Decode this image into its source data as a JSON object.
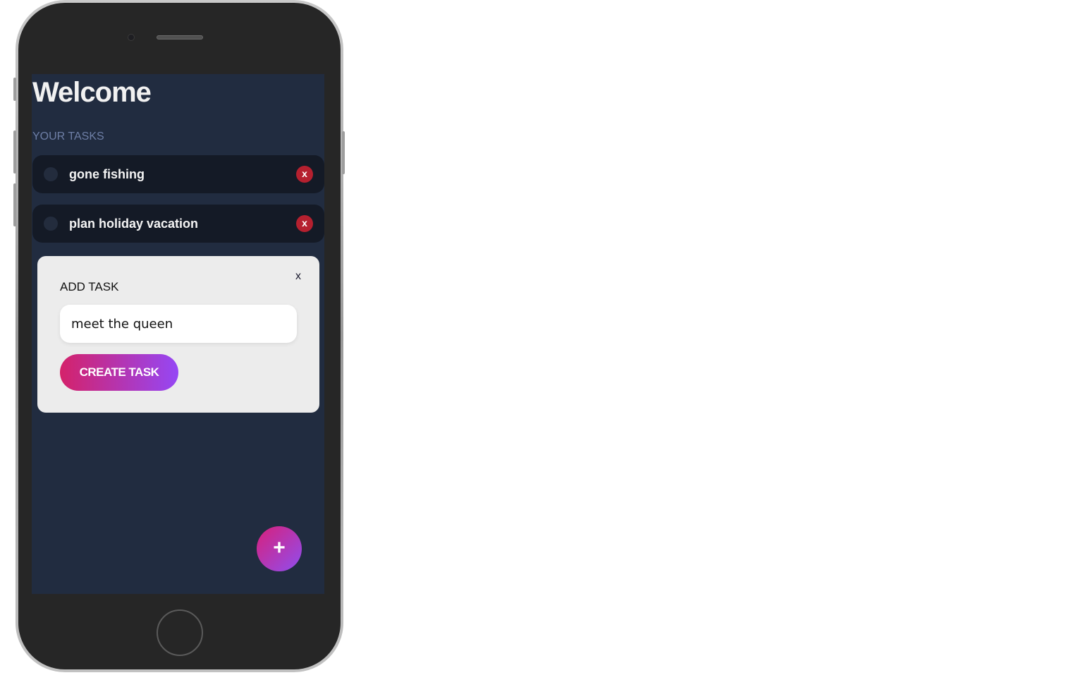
{
  "screen": {
    "title": "Welcome",
    "section_label": "YOUR TASKS"
  },
  "tasks": [
    {
      "label": "gone fishing",
      "delete_label": "x"
    },
    {
      "label": "plan holiday vacation",
      "delete_label": "x"
    }
  ],
  "modal": {
    "close_label": "x",
    "title": "ADD TASK",
    "input_value": "meet the queen",
    "input_placeholder": "",
    "submit_label": "CREATE TASK"
  },
  "fab": {
    "label": "+"
  },
  "colors": {
    "screen_bg": "#212c40",
    "task_bg": "#141a26",
    "delete_red": "#b5202f",
    "accent_start": "#d4226a",
    "accent_end": "#9547f5",
    "section_label": "#6e7fa6"
  },
  "icons": {
    "task_checkbox": "circle-checkbox-icon",
    "task_delete": "close-icon",
    "fab": "plus-icon"
  }
}
